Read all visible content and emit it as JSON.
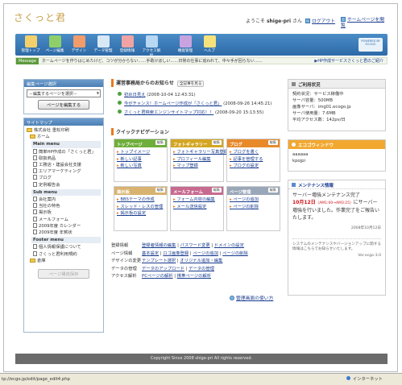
{
  "header": {
    "logo": "さくっと君",
    "welcome_prefix": "ようこそ",
    "user": "shige-pri",
    "welcome_suffix": "さん",
    "logout": "ログアウト",
    "view_homepage": "ホームページを閲覧"
  },
  "menu": {
    "items": [
      "管理トップ",
      "ページ編集",
      "デザイン",
      "データ管理",
      "登録情報",
      "アクセス解析",
      "機能管理",
      "ヘルプ"
    ],
    "brand": "POWERED BY ECOGO"
  },
  "message": {
    "label": "Message",
    "text": "ホームページを作りはじめたけど、コツが分からない……手助けほしい……日常の仕事に追われて、中々手が回らない……",
    "more": "▶HP作成サービスさくっと君のご紹介"
  },
  "sidebar": {
    "edit_select_title": "編集ページ選択",
    "select_value": "－編集するページを選択－",
    "edit_page_button": "ページを編集する",
    "sitemap_title": "サイトマップ",
    "company": "株式会社 重松印刷",
    "home": "ホーム",
    "main_menu": "Main menu",
    "main_items": [
      "簡単HP作成の「さくっと君」",
      "取扱商品",
      "工務店・建設会社支援",
      "エリアマーケティング",
      "ブログ",
      "定例報告会"
    ],
    "sub_menu": "Sub menu",
    "sub_items": [
      "会社案内",
      "当社の特色",
      "掲示板",
      "メールフォーム",
      "2009年度 カレンダー",
      "2009年度 年賀状"
    ],
    "footer_menu": "Footer menu",
    "footer_items": [
      "個人情報保護について",
      "さくっと君利用規約"
    ],
    "warehouse": "倉庫",
    "save_button": "ページ構成保存"
  },
  "notices": {
    "title": "運営事務局からのお知らせ",
    "all_link": "全記事を見る",
    "items": [
      {
        "text": "初め日見え",
        "date": "(2008-10-04 12:43:31)"
      },
      {
        "text": "今がチャンス！ホームページ作成が「さくっと君」",
        "date": "(2008-09-26 14:45:21)"
      },
      {
        "text": "さくっと君検索エンジンサイトマップ対応！！",
        "date": "(2008-09-20 15:13:55)"
      }
    ]
  },
  "quicknav": {
    "title": "クイックナビゲーション",
    "edit": "編集",
    "boxes": [
      {
        "title": "トップページ",
        "color": "#6fae3a",
        "links": [
          "トップイメージ",
          "新しい記事",
          "新しい写真"
        ]
      },
      {
        "title": "フォトギャラリー",
        "color": "#d4a624",
        "links": [
          "フォトギャラリー写真登録",
          "プロフィール編集",
          "マップ登録"
        ]
      },
      {
        "title": "ブログ",
        "color": "#e88a2a",
        "links": [
          "ブログを書く",
          "記事を管理する",
          "ブログの設定"
        ]
      },
      {
        "title": "掲示板",
        "color": "#d8b370",
        "links": [
          "BBSテーマの作成",
          "スレッド・レスの管理",
          "掲示板の設定"
        ]
      },
      {
        "title": "メールフォーム",
        "color": "#c76a8f",
        "links": [
          "フォーム内容の編集",
          "メール送信設定"
        ]
      },
      {
        "title": "ページ管理",
        "color": "#9aa7b8",
        "links": [
          "ページの追加",
          "ページの削除"
        ]
      }
    ]
  },
  "settings": {
    "rows": [
      {
        "k": "登録情報",
        "v": [
          "登録者情報の編集",
          "パスワード変更",
          "ドメインの設定"
        ]
      },
      {
        "k": "ページ情報",
        "v": [
          "基本設定",
          "ロゴ画像登録",
          "ページの追加",
          "ページの削除"
        ]
      },
      {
        "k": "デザインの変更",
        "v": [
          "テンプレート選択",
          "オリジナル追加・編集"
        ]
      },
      {
        "k": "データの管理",
        "v": [
          "データのアップロード",
          "データの管理"
        ]
      },
      {
        "k": "アクセス解析",
        "v": [
          "PCページの解析",
          "携帯ページの解析"
        ]
      }
    ],
    "help_link": "管理画面の使い方"
  },
  "contract": {
    "title": "ご利用状況",
    "lines": [
      "契約状況：サービス稼働中",
      "サーバ容量：500MB",
      "画像サーバ：img01.ecogo.jp",
      "サーバ使用量：7.6MB",
      "平均アクセス数：142pv/日"
    ]
  },
  "ecogo_id": {
    "title": "エコゴウィンドウ",
    "lines": [
      "aaaaaa",
      "kpojpi"
    ]
  },
  "maintenance": {
    "title": "メンテナンス情報",
    "headline": "サーバー増強メンテナンス完了",
    "date": "10月12日",
    "time": "（AM1:00→AM3:25）",
    "body": "にサーバー増強を行いました。作業完了をご報告いたします。",
    "stamp": "2008年10月12日",
    "note": "システムのメンテナンスやバージョンアップに関する情報はこちらでお知らせいたします。",
    "version": "Ver.ecgo-3.0"
  },
  "footer": {
    "copyright": "Copyright Since 2008 shige-pri All rights reserved."
  },
  "status": {
    "url": "tp://ecgo.jp/edit/page_edit4.php",
    "zone": "インターネット"
  }
}
